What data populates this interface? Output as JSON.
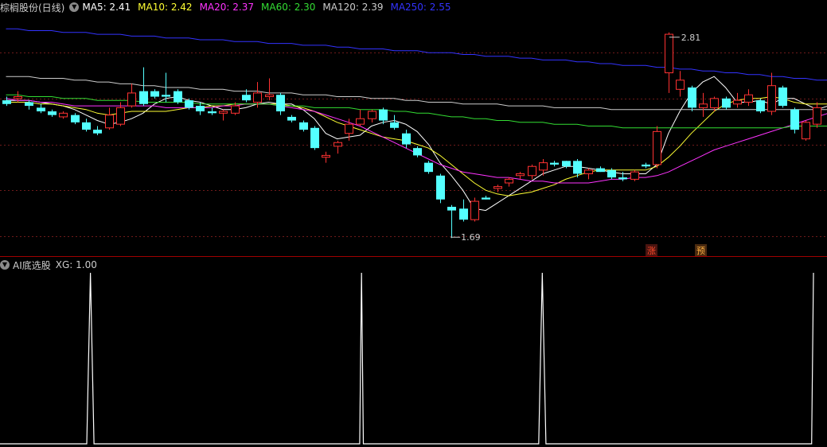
{
  "main_panel": {
    "title": "棕榈股份(日线)",
    "indicators": [
      {
        "label": "MA5: 2.41",
        "color": "#ffffff"
      },
      {
        "label": "MA10: 2.42",
        "color": "#ffff33"
      },
      {
        "label": "MA20: 2.37",
        "color": "#ff33ff"
      },
      {
        "label": "MA60: 2.30",
        "color": "#33dd33"
      },
      {
        "label": "MA120: 2.39",
        "color": "#cccccc"
      },
      {
        "label": "MA250: 2.55",
        "color": "#3333ff"
      }
    ],
    "high_label": "2.81",
    "low_label": "1.69",
    "marker_zhang": "涨",
    "marker_yu": "预"
  },
  "sub_panel": {
    "title": "AI底选股",
    "indicator": "XG: 1.00"
  },
  "colors": {
    "up": "#ff3232",
    "down": "#54ffff",
    "grid": "#6e1a1a",
    "separator": "#a00000",
    "xg_line": "#ffffff"
  },
  "chart_data": [
    {
      "type": "candlestick",
      "title": "棕榈股份(日线)",
      "ylim": [
        1.6,
        2.9
      ],
      "candles": [
        {
          "o": 2.44,
          "h": 2.46,
          "l": 2.41,
          "c": 2.42
        },
        {
          "o": 2.45,
          "h": 2.49,
          "l": 2.43,
          "c": 2.46
        },
        {
          "o": 2.43,
          "h": 2.44,
          "l": 2.39,
          "c": 2.41
        },
        {
          "o": 2.4,
          "h": 2.42,
          "l": 2.37,
          "c": 2.38
        },
        {
          "o": 2.38,
          "h": 2.39,
          "l": 2.35,
          "c": 2.36
        },
        {
          "o": 2.35,
          "h": 2.38,
          "l": 2.34,
          "c": 2.37
        },
        {
          "o": 2.36,
          "h": 2.37,
          "l": 2.31,
          "c": 2.32
        },
        {
          "o": 2.32,
          "h": 2.34,
          "l": 2.27,
          "c": 2.28
        },
        {
          "o": 2.28,
          "h": 2.3,
          "l": 2.25,
          "c": 2.26
        },
        {
          "o": 2.29,
          "h": 2.4,
          "l": 2.28,
          "c": 2.36
        },
        {
          "o": 2.31,
          "h": 2.43,
          "l": 2.3,
          "c": 2.4
        },
        {
          "o": 2.41,
          "h": 2.53,
          "l": 2.4,
          "c": 2.48
        },
        {
          "o": 2.49,
          "h": 2.62,
          "l": 2.41,
          "c": 2.42
        },
        {
          "o": 2.49,
          "h": 2.5,
          "l": 2.45,
          "c": 2.46
        },
        {
          "o": 2.47,
          "h": 2.59,
          "l": 2.43,
          "c": 2.46
        },
        {
          "o": 2.49,
          "h": 2.5,
          "l": 2.42,
          "c": 2.43
        },
        {
          "o": 2.44,
          "h": 2.45,
          "l": 2.39,
          "c": 2.4
        },
        {
          "o": 2.41,
          "h": 2.43,
          "l": 2.36,
          "c": 2.38
        },
        {
          "o": 2.38,
          "h": 2.4,
          "l": 2.36,
          "c": 2.37
        },
        {
          "o": 2.37,
          "h": 2.39,
          "l": 2.33,
          "c": 2.38
        },
        {
          "o": 2.37,
          "h": 2.43,
          "l": 2.36,
          "c": 2.41
        },
        {
          "o": 2.47,
          "h": 2.5,
          "l": 2.43,
          "c": 2.44
        },
        {
          "o": 2.43,
          "h": 2.54,
          "l": 2.4,
          "c": 2.48
        },
        {
          "o": 2.46,
          "h": 2.56,
          "l": 2.44,
          "c": 2.47
        },
        {
          "o": 2.47,
          "h": 2.48,
          "l": 2.36,
          "c": 2.38
        },
        {
          "o": 2.35,
          "h": 2.36,
          "l": 2.32,
          "c": 2.33
        },
        {
          "o": 2.32,
          "h": 2.33,
          "l": 2.27,
          "c": 2.28
        },
        {
          "o": 2.29,
          "h": 2.3,
          "l": 2.17,
          "c": 2.18
        },
        {
          "o": 2.13,
          "h": 2.16,
          "l": 2.1,
          "c": 2.14
        },
        {
          "o": 2.19,
          "h": 2.22,
          "l": 2.15,
          "c": 2.21
        },
        {
          "o": 2.26,
          "h": 2.34,
          "l": 2.22,
          "c": 2.31
        },
        {
          "o": 2.31,
          "h": 2.39,
          "l": 2.3,
          "c": 2.34
        },
        {
          "o": 2.34,
          "h": 2.39,
          "l": 2.32,
          "c": 2.38
        },
        {
          "o": 2.39,
          "h": 2.4,
          "l": 2.31,
          "c": 2.33
        },
        {
          "o": 2.32,
          "h": 2.36,
          "l": 2.28,
          "c": 2.29
        },
        {
          "o": 2.26,
          "h": 2.28,
          "l": 2.18,
          "c": 2.2
        },
        {
          "o": 2.18,
          "h": 2.19,
          "l": 2.13,
          "c": 2.14
        },
        {
          "o": 2.1,
          "h": 2.11,
          "l": 2.04,
          "c": 2.05
        },
        {
          "o": 2.03,
          "h": 2.04,
          "l": 1.88,
          "c": 1.9
        },
        {
          "o": 1.86,
          "h": 1.87,
          "l": 1.69,
          "c": 1.84
        },
        {
          "o": 1.85,
          "h": 1.9,
          "l": 1.78,
          "c": 1.79
        },
        {
          "o": 1.79,
          "h": 1.91,
          "l": 1.78,
          "c": 1.89
        },
        {
          "o": 1.91,
          "h": 1.92,
          "l": 1.9,
          "c": 1.9
        },
        {
          "o": 1.96,
          "h": 1.98,
          "l": 1.94,
          "c": 1.97
        },
        {
          "o": 1.99,
          "h": 2.02,
          "l": 1.97,
          "c": 2.01
        },
        {
          "o": 2.03,
          "h": 2.05,
          "l": 2.01,
          "c": 2.04
        },
        {
          "o": 2.03,
          "h": 2.09,
          "l": 2.01,
          "c": 2.08
        },
        {
          "o": 2.06,
          "h": 2.12,
          "l": 2.03,
          "c": 2.1
        },
        {
          "o": 2.1,
          "h": 2.11,
          "l": 2.08,
          "c": 2.09
        },
        {
          "o": 2.11,
          "h": 2.11,
          "l": 2.07,
          "c": 2.08
        },
        {
          "o": 2.11,
          "h": 2.12,
          "l": 2.02,
          "c": 2.04
        },
        {
          "o": 2.04,
          "h": 2.07,
          "l": 2.01,
          "c": 2.06
        },
        {
          "o": 2.07,
          "h": 2.08,
          "l": 2.05,
          "c": 2.05
        },
        {
          "o": 2.06,
          "h": 2.07,
          "l": 2.01,
          "c": 2.02
        },
        {
          "o": 2.02,
          "h": 2.05,
          "l": 2.0,
          "c": 2.01
        },
        {
          "o": 2.01,
          "h": 2.06,
          "l": 2.0,
          "c": 2.05
        },
        {
          "o": 2.09,
          "h": 2.1,
          "l": 2.07,
          "c": 2.08
        },
        {
          "o": 2.09,
          "h": 2.3,
          "l": 2.07,
          "c": 2.27
        },
        {
          "o": 2.59,
          "h": 2.81,
          "l": 2.48,
          "c": 2.8
        },
        {
          "o": 2.5,
          "h": 2.6,
          "l": 2.46,
          "c": 2.55
        },
        {
          "o": 2.51,
          "h": 2.52,
          "l": 2.38,
          "c": 2.4
        },
        {
          "o": 2.4,
          "h": 2.48,
          "l": 2.35,
          "c": 2.42
        },
        {
          "o": 2.4,
          "h": 2.46,
          "l": 2.38,
          "c": 2.45
        },
        {
          "o": 2.45,
          "h": 2.46,
          "l": 2.39,
          "c": 2.4
        },
        {
          "o": 2.42,
          "h": 2.48,
          "l": 2.4,
          "c": 2.44
        },
        {
          "o": 2.43,
          "h": 2.5,
          "l": 2.41,
          "c": 2.47
        },
        {
          "o": 2.44,
          "h": 2.45,
          "l": 2.37,
          "c": 2.38
        },
        {
          "o": 2.38,
          "h": 2.59,
          "l": 2.36,
          "c": 2.52
        },
        {
          "o": 2.51,
          "h": 2.52,
          "l": 2.4,
          "c": 2.41
        },
        {
          "o": 2.39,
          "h": 2.4,
          "l": 2.26,
          "c": 2.28
        },
        {
          "o": 2.23,
          "h": 2.33,
          "l": 2.22,
          "c": 2.32
        },
        {
          "o": 2.31,
          "h": 2.43,
          "l": 2.29,
          "c": 2.4
        }
      ],
      "moving_averages": [
        {
          "name": "MA5",
          "values": [
            2.44,
            2.44,
            2.44,
            2.43,
            2.42,
            2.41,
            2.39,
            2.36,
            2.33,
            2.31,
            2.32,
            2.34,
            2.37,
            2.42,
            2.45,
            2.46,
            2.44,
            2.43,
            2.41,
            2.39,
            2.39,
            2.4,
            2.42,
            2.43,
            2.42,
            2.42,
            2.39,
            2.34,
            2.26,
            2.23,
            2.24,
            2.25,
            2.3,
            2.32,
            2.33,
            2.31,
            2.27,
            2.2,
            2.1,
            2.03,
            1.95,
            1.85,
            1.84,
            1.88,
            1.92,
            1.96,
            2.0,
            2.04,
            2.06,
            2.08,
            2.08,
            2.07,
            2.06,
            2.05,
            2.04,
            2.04,
            2.04,
            2.09,
            2.26,
            2.38,
            2.48,
            2.54,
            2.57,
            2.51,
            2.43,
            2.43,
            2.44,
            2.42,
            2.45,
            2.45,
            2.42,
            2.39,
            2.41
          ]
        },
        {
          "name": "MA10",
          "values": [
            2.43,
            2.43,
            2.43,
            2.42,
            2.42,
            2.41,
            2.4,
            2.39,
            2.37,
            2.36,
            2.37,
            2.38,
            2.38,
            2.38,
            2.38,
            2.39,
            2.4,
            2.4,
            2.41,
            2.41,
            2.42,
            2.42,
            2.42,
            2.42,
            2.42,
            2.41,
            2.4,
            2.38,
            2.35,
            2.32,
            2.3,
            2.28,
            2.26,
            2.24,
            2.23,
            2.22,
            2.2,
            2.18,
            2.14,
            2.09,
            2.04,
            1.99,
            1.95,
            1.93,
            1.92,
            1.93,
            1.94,
            1.96,
            1.98,
            2.01,
            2.03,
            2.05,
            2.06,
            2.06,
            2.06,
            2.06,
            2.06,
            2.08,
            2.13,
            2.19,
            2.26,
            2.32,
            2.38,
            2.42,
            2.44,
            2.45,
            2.45,
            2.46,
            2.45,
            2.43,
            2.42,
            2.42,
            2.42
          ]
        },
        {
          "name": "MA20",
          "values": [
            2.45,
            2.44,
            2.44,
            2.43,
            2.43,
            2.42,
            2.41,
            2.41,
            2.41,
            2.41,
            2.41,
            2.41,
            2.41,
            2.41,
            2.4,
            2.4,
            2.4,
            2.4,
            2.4,
            2.41,
            2.41,
            2.42,
            2.42,
            2.42,
            2.41,
            2.4,
            2.39,
            2.38,
            2.36,
            2.34,
            2.32,
            2.3,
            2.27,
            2.24,
            2.21,
            2.18,
            2.15,
            2.12,
            2.09,
            2.07,
            2.05,
            2.04,
            2.03,
            2.02,
            2.02,
            2.01,
            2.0,
            2.0,
            1.99,
            1.99,
            1.99,
            1.99,
            2.0,
            2.01,
            2.01,
            2.02,
            2.02,
            2.03,
            2.05,
            2.08,
            2.11,
            2.14,
            2.17,
            2.19,
            2.21,
            2.23,
            2.25,
            2.27,
            2.29,
            2.31,
            2.33,
            2.35,
            2.37
          ]
        },
        {
          "name": "MA60",
          "values": [
            2.47,
            2.47,
            2.46,
            2.46,
            2.46,
            2.45,
            2.45,
            2.45,
            2.44,
            2.44,
            2.44,
            2.44,
            2.43,
            2.43,
            2.43,
            2.43,
            2.43,
            2.42,
            2.42,
            2.42,
            2.42,
            2.42,
            2.42,
            2.42,
            2.41,
            2.41,
            2.41,
            2.4,
            2.4,
            2.4,
            2.4,
            2.39,
            2.39,
            2.39,
            2.38,
            2.38,
            2.37,
            2.37,
            2.36,
            2.35,
            2.35,
            2.34,
            2.34,
            2.33,
            2.33,
            2.32,
            2.32,
            2.32,
            2.31,
            2.31,
            2.31,
            2.3,
            2.3,
            2.3,
            2.29,
            2.29,
            2.29,
            2.29,
            2.29,
            2.29,
            2.29,
            2.29,
            2.29,
            2.29,
            2.29,
            2.29,
            2.29,
            2.29,
            2.29,
            2.3,
            2.3,
            2.3,
            2.3
          ]
        },
        {
          "name": "MA120",
          "values": [
            2.57,
            2.57,
            2.57,
            2.56,
            2.56,
            2.56,
            2.55,
            2.55,
            2.54,
            2.54,
            2.53,
            2.53,
            2.52,
            2.52,
            2.51,
            2.51,
            2.51,
            2.5,
            2.5,
            2.5,
            2.49,
            2.49,
            2.49,
            2.48,
            2.48,
            2.48,
            2.47,
            2.47,
            2.47,
            2.46,
            2.46,
            2.46,
            2.45,
            2.45,
            2.45,
            2.44,
            2.44,
            2.43,
            2.43,
            2.43,
            2.42,
            2.42,
            2.42,
            2.42,
            2.41,
            2.41,
            2.41,
            2.41,
            2.4,
            2.4,
            2.4,
            2.4,
            2.4,
            2.39,
            2.39,
            2.39,
            2.39,
            2.39,
            2.39,
            2.39,
            2.39,
            2.39,
            2.39,
            2.39,
            2.39,
            2.39,
            2.39,
            2.39,
            2.39,
            2.39,
            2.39,
            2.39,
            2.39
          ]
        },
        {
          "name": "MA250",
          "values": [
            2.83,
            2.83,
            2.82,
            2.82,
            2.82,
            2.81,
            2.81,
            2.81,
            2.8,
            2.8,
            2.8,
            2.79,
            2.79,
            2.79,
            2.78,
            2.78,
            2.78,
            2.77,
            2.77,
            2.77,
            2.76,
            2.76,
            2.76,
            2.75,
            2.75,
            2.75,
            2.74,
            2.74,
            2.74,
            2.73,
            2.73,
            2.72,
            2.72,
            2.72,
            2.71,
            2.71,
            2.71,
            2.7,
            2.7,
            2.7,
            2.69,
            2.69,
            2.68,
            2.68,
            2.68,
            2.67,
            2.67,
            2.66,
            2.66,
            2.66,
            2.65,
            2.65,
            2.64,
            2.64,
            2.63,
            2.63,
            2.63,
            2.62,
            2.62,
            2.61,
            2.61,
            2.6,
            2.6,
            2.59,
            2.59,
            2.58,
            2.58,
            2.57,
            2.57,
            2.56,
            2.56,
            2.55,
            2.55
          ]
        }
      ]
    },
    {
      "type": "line",
      "title": "AI底选股",
      "series": [
        {
          "name": "XG",
          "values": [
            [
              0.96,
              0
            ],
            [
              1.0,
              1
            ],
            [
              1.04,
              0
            ],
            [
              3.98,
              0
            ],
            [
              4.0,
              1
            ],
            [
              4.02,
              0
            ],
            [
              5.96,
              0
            ],
            [
              6.0,
              1
            ],
            [
              6.04,
              0
            ],
            [
              8.98,
              0
            ],
            [
              9.0,
              1
            ]
          ]
        }
      ],
      "x_range": [
        0,
        9.15
      ],
      "ylim": [
        0,
        1
      ]
    }
  ]
}
